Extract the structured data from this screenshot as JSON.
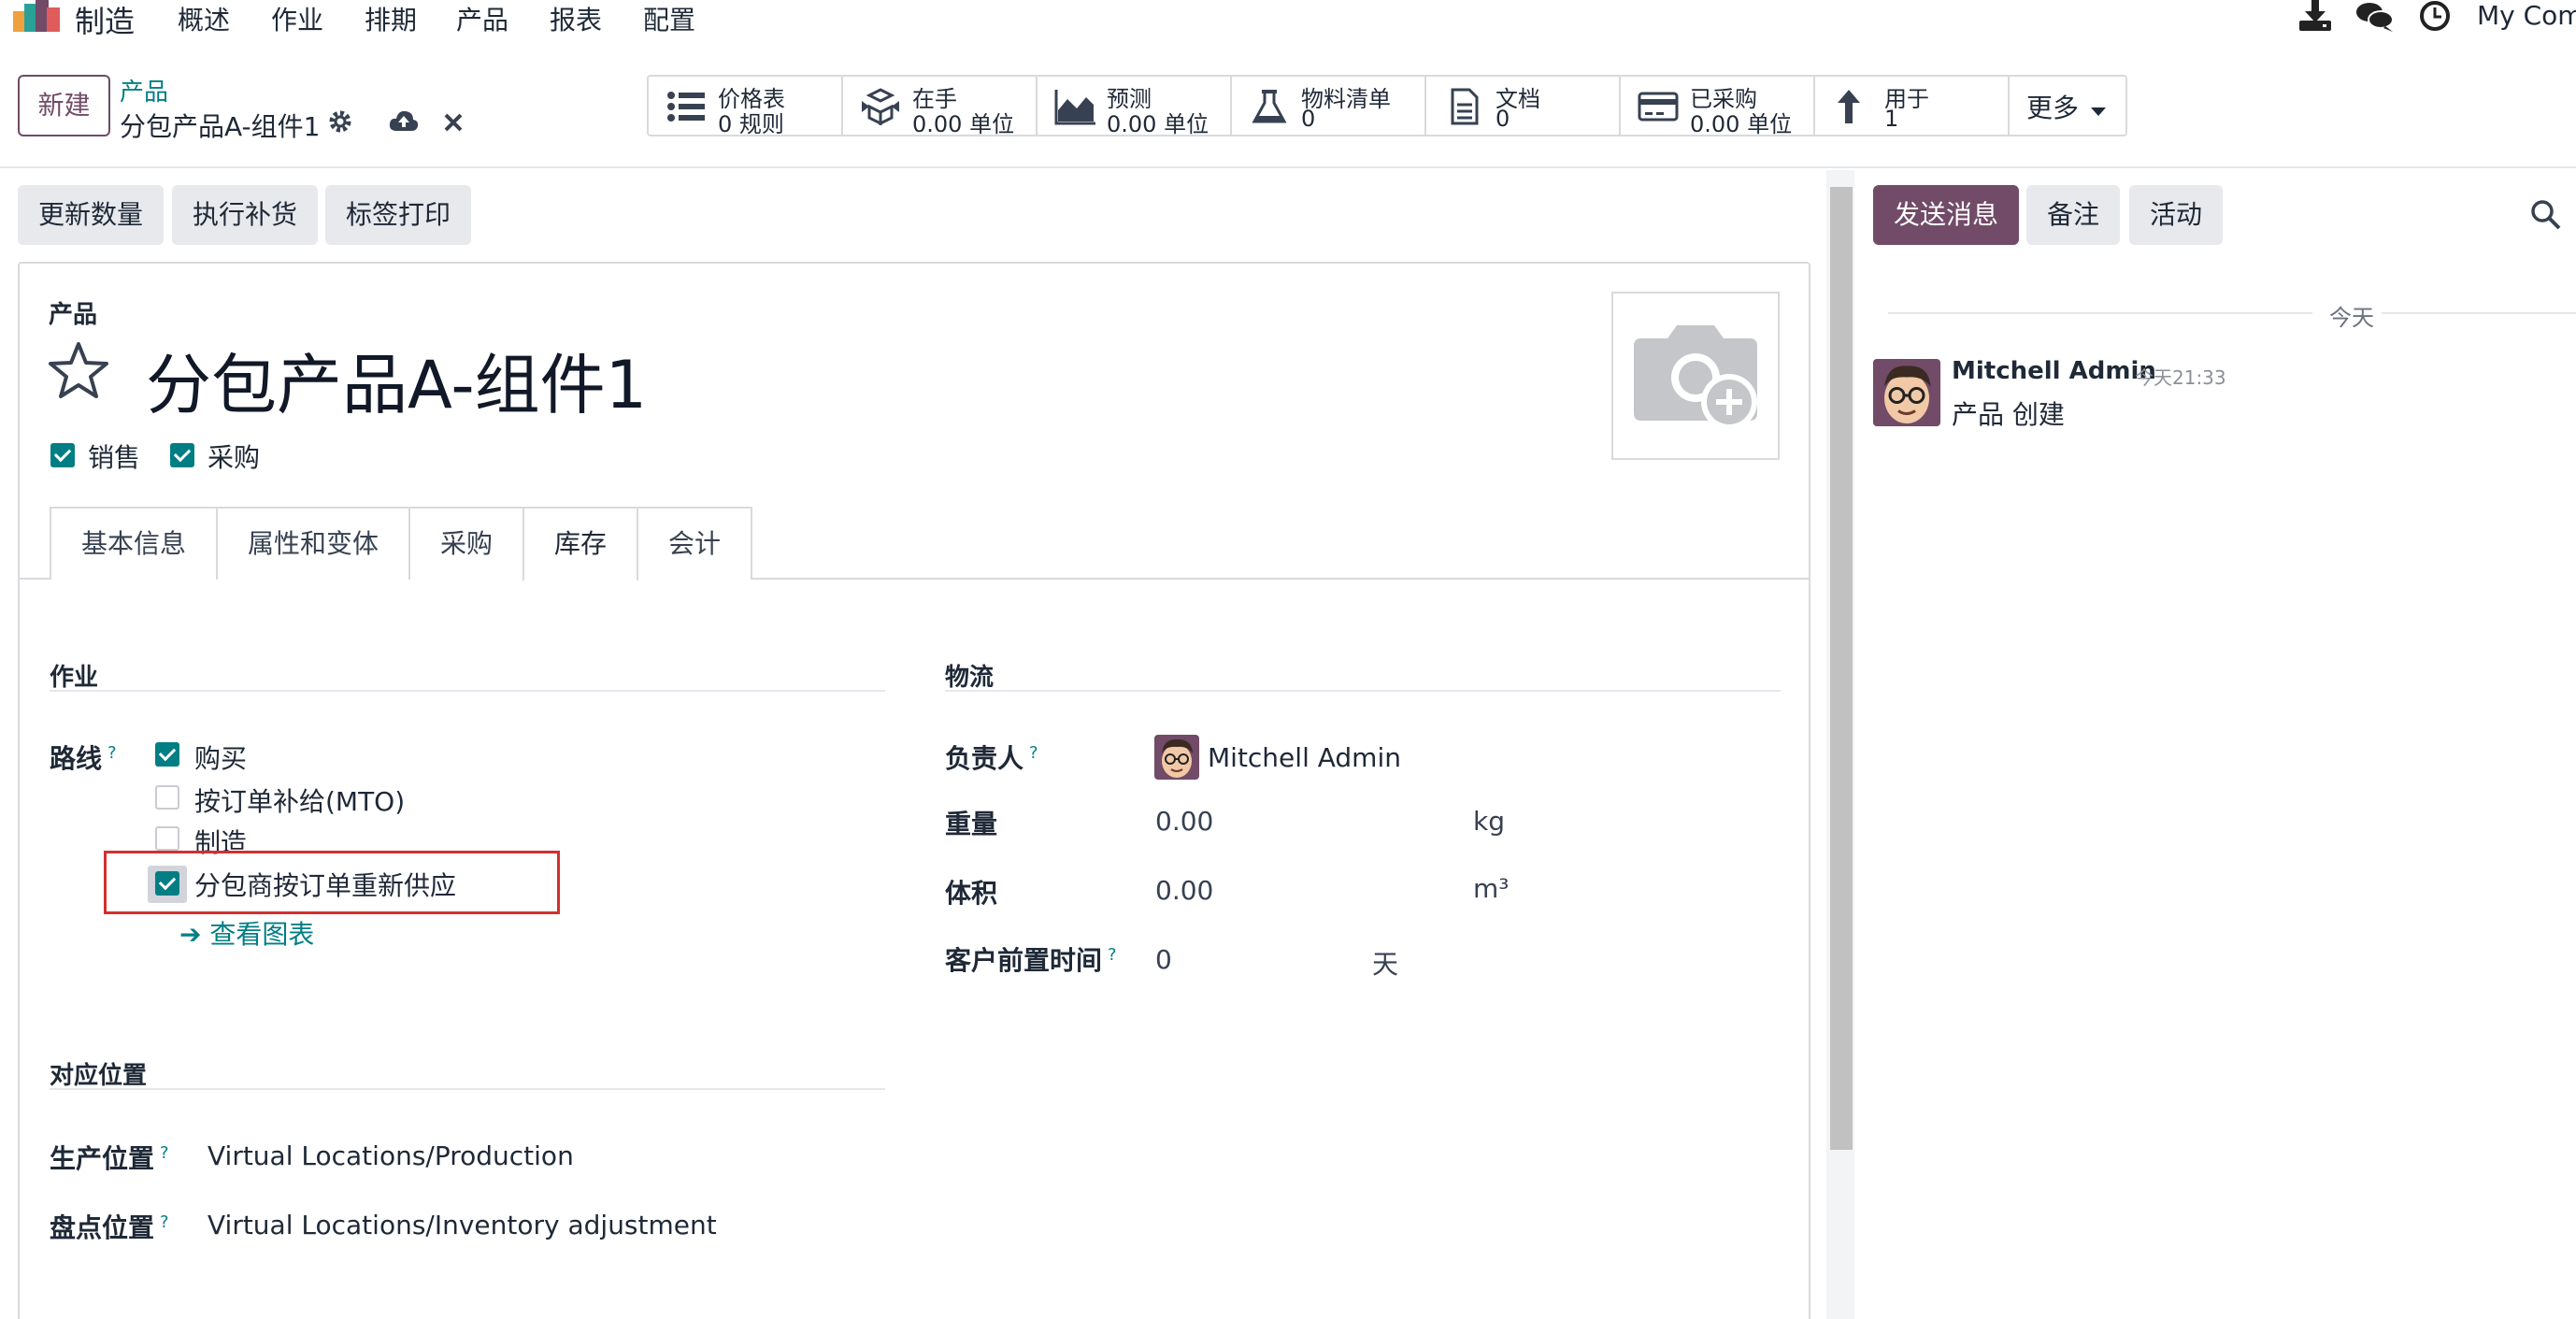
{
  "nav": {
    "app_name": "制造",
    "menus": [
      "概述",
      "作业",
      "排期",
      "产品",
      "报表",
      "配置"
    ],
    "company": "My Com",
    "icons": [
      "download-icon",
      "chat-icon",
      "clock-icon"
    ]
  },
  "control": {
    "new_button": "新建",
    "breadcrumb_parent": "产品",
    "breadcrumb_current": "分包产品A-组件1",
    "stats": [
      {
        "icon": "list-icon",
        "label": "价格表",
        "value": "0 规则"
      },
      {
        "icon": "cubes-icon",
        "label": "在手",
        "value": "0.00 单位"
      },
      {
        "icon": "area-chart-icon",
        "label": "预测",
        "value": "0.00 单位"
      },
      {
        "icon": "flask-icon",
        "label": "物料清单",
        "value": "0"
      },
      {
        "icon": "document-icon",
        "label": "文档",
        "value": "0"
      },
      {
        "icon": "credit-card-icon",
        "label": "已采购",
        "value": "0.00 单位"
      },
      {
        "icon": "arrow-up-icon",
        "label": "用于",
        "value": "1"
      }
    ],
    "more": "更多"
  },
  "actions": [
    "更新数量",
    "执行补货",
    "标签打印"
  ],
  "form": {
    "product_label": "产品",
    "product_name": "分包产品A-组件1",
    "flags": [
      {
        "label": "销售",
        "checked": true
      },
      {
        "label": "采购",
        "checked": true
      }
    ],
    "tabs": [
      "基本信息",
      "属性和变体",
      "采购",
      "库存",
      "会计"
    ],
    "active_tab": "库存",
    "operations": {
      "title": "作业",
      "routes_label": "路线",
      "routes": [
        {
          "label": "购买",
          "checked": true
        },
        {
          "label": "按订单补给(MTO)",
          "checked": false
        },
        {
          "label": "制造",
          "checked": false
        },
        {
          "label": "分包商按订单重新供应",
          "checked": true
        }
      ],
      "view_diagram": "查看图表"
    },
    "logistics": {
      "title": "物流",
      "responsible_label": "负责人",
      "responsible_value": "Mitchell Admin",
      "weight_label": "重量",
      "weight_value": "0.00",
      "weight_unit": "kg",
      "volume_label": "体积",
      "volume_value": "0.00",
      "volume_unit": "m³",
      "lead_label": "客户前置时间",
      "lead_value": "0",
      "lead_unit": "天"
    },
    "locations": {
      "title": "对应位置",
      "production_label": "生产位置",
      "production_value": "Virtual Locations/Production",
      "inventory_label": "盘点位置",
      "inventory_value": "Virtual Locations/Inventory adjustment"
    }
  },
  "chatter": {
    "send_message": "发送消息",
    "log_note": "备注",
    "activity": "活动",
    "today": "今天",
    "message": {
      "author": "Mitchell Admin",
      "time": "今天21:33",
      "body": "产品 创建"
    }
  },
  "colors": {
    "brand": "#714b67",
    "accent": "#017e84",
    "highlight": "#d32f2f"
  }
}
